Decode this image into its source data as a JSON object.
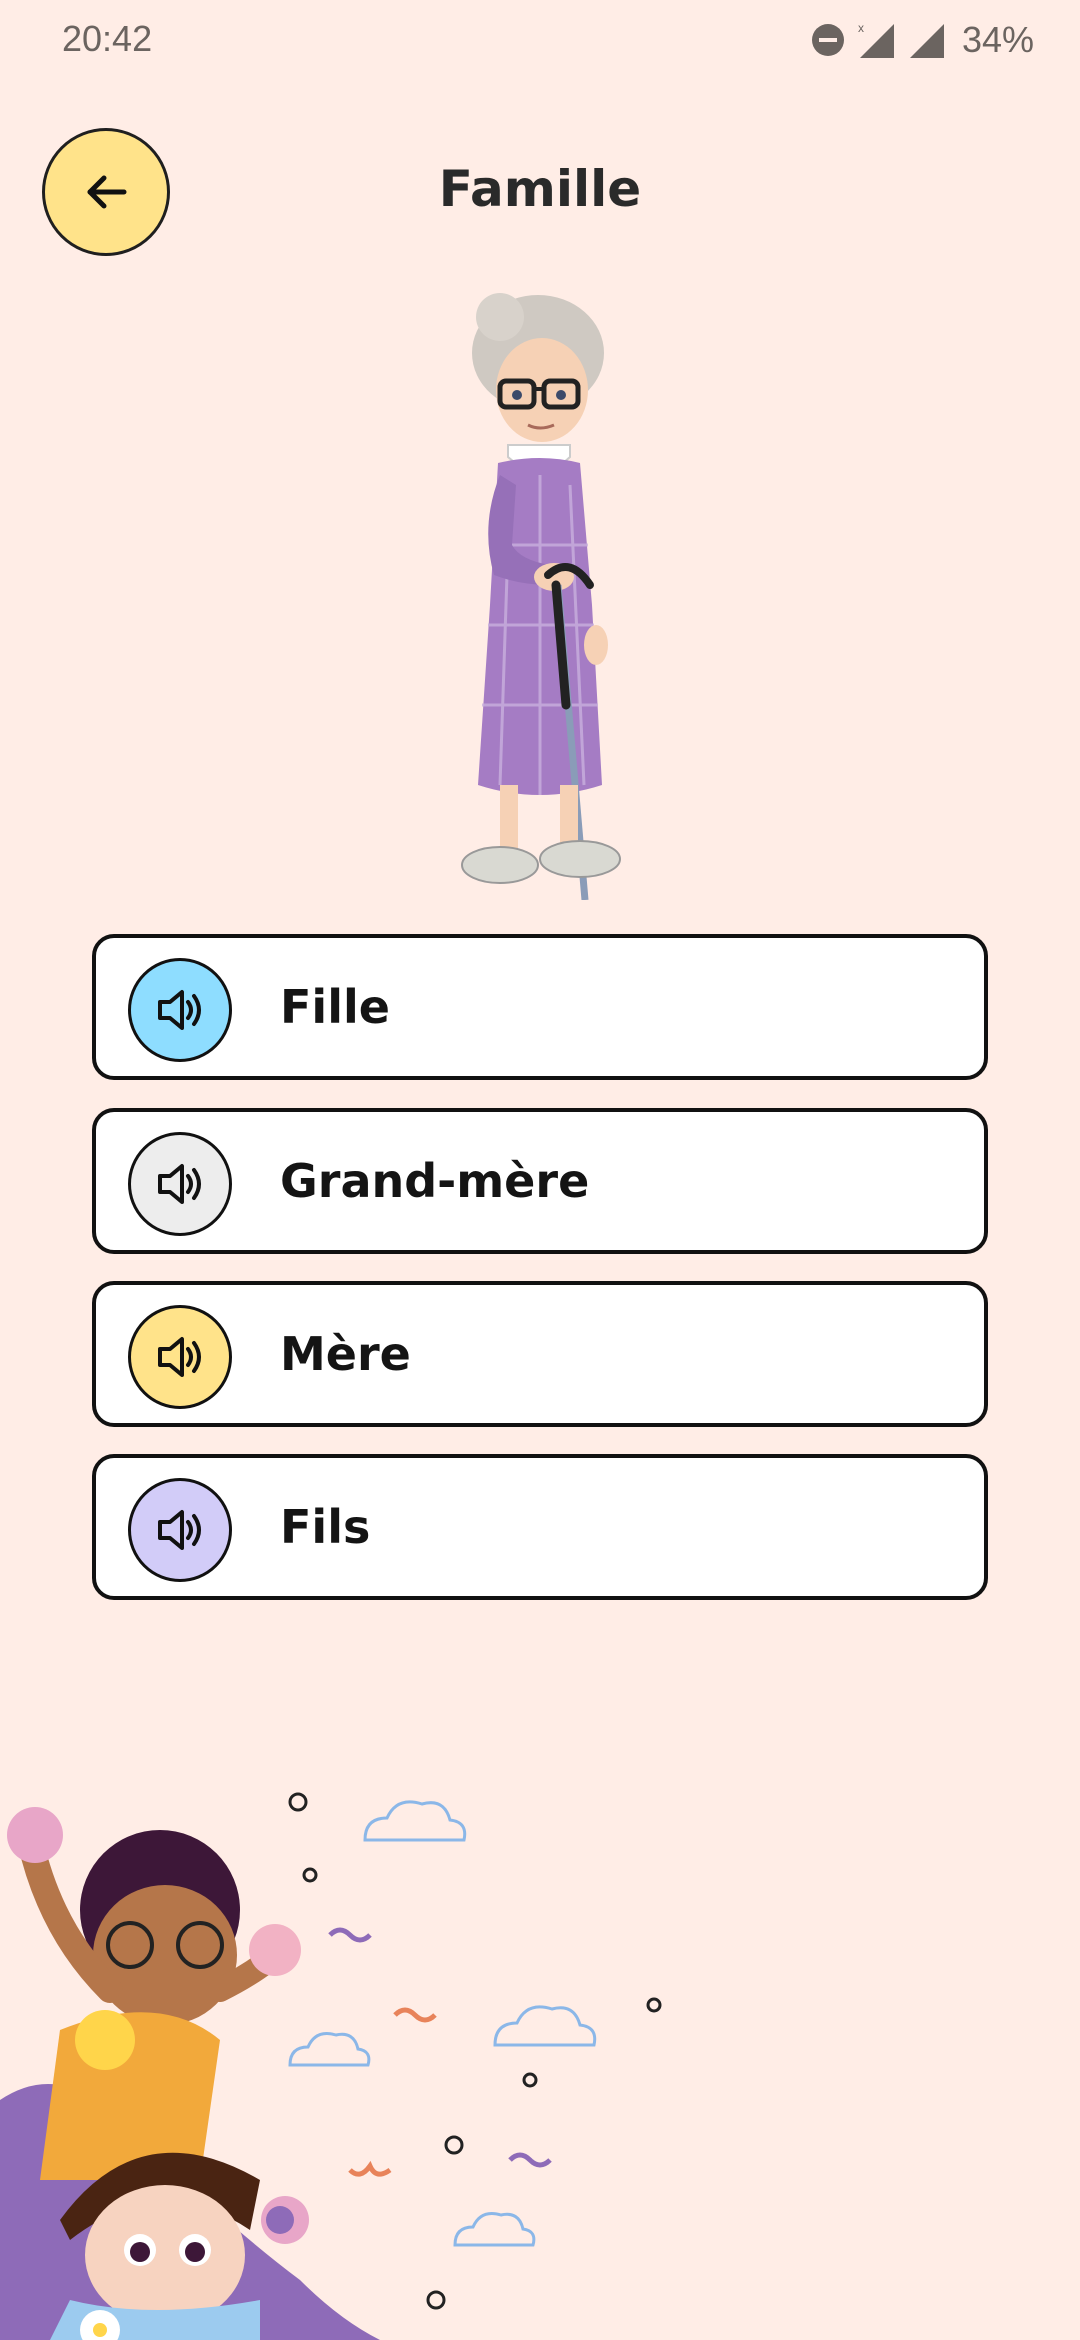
{
  "status": {
    "time": "20:42",
    "battery": "34%",
    "icons": [
      "do-not-disturb-icon",
      "no-data-signal-icon",
      "signal-icon"
    ]
  },
  "header": {
    "title": "Famille",
    "back_icon": "arrow-left-icon"
  },
  "picture": {
    "subject": "grandmother-illustration"
  },
  "options": [
    {
      "label": "Fille",
      "icon": "speaker-icon",
      "color": "#8EDDFF"
    },
    {
      "label": "Grand-mère",
      "icon": "speaker-icon",
      "color": "#EDEDED"
    },
    {
      "label": "Mère",
      "icon": "speaker-icon",
      "color": "#FFE38A"
    },
    {
      "label": "Fils",
      "icon": "speaker-icon",
      "color": "#D2CCF8"
    }
  ],
  "colors": {
    "background": "#FFEDE6",
    "accent_yellow": "#FFE38A"
  }
}
